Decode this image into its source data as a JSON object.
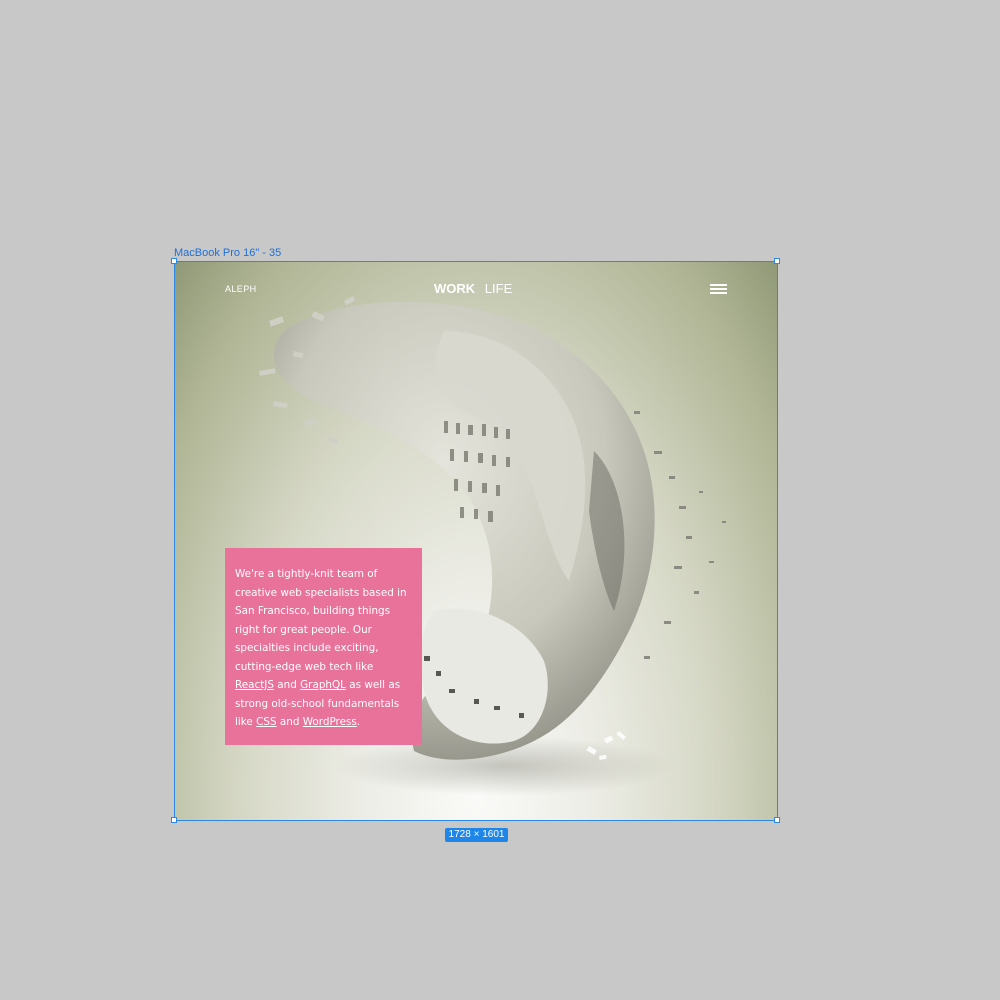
{
  "canvas": {
    "frame_label": "MacBook Pro 16\" - 35",
    "size_badge": "1728 × 1601",
    "selection_color": "#2b8ae8"
  },
  "site": {
    "logo": "ALEPH",
    "nav": {
      "work": "WORK",
      "life": "LIFE"
    },
    "menu_icon": "hamburger-menu-icon",
    "intro": {
      "t1": "We're a tightly-knit team of creative web specialists based in San Francisco, building things right for great people. Our specialties include exciting, cutting-edge web tech like ",
      "link1": "ReactJS",
      "t2": " and ",
      "link2": "GraphQL",
      "t3": " as well as strong old-school fundamentals like ",
      "link3": "CSS",
      "t4": " and ",
      "link4": "WordPress",
      "t5": "."
    },
    "intro_box_color": "#e8729a",
    "background_gradient": [
      "#fafaf8",
      "#8f9876"
    ]
  }
}
